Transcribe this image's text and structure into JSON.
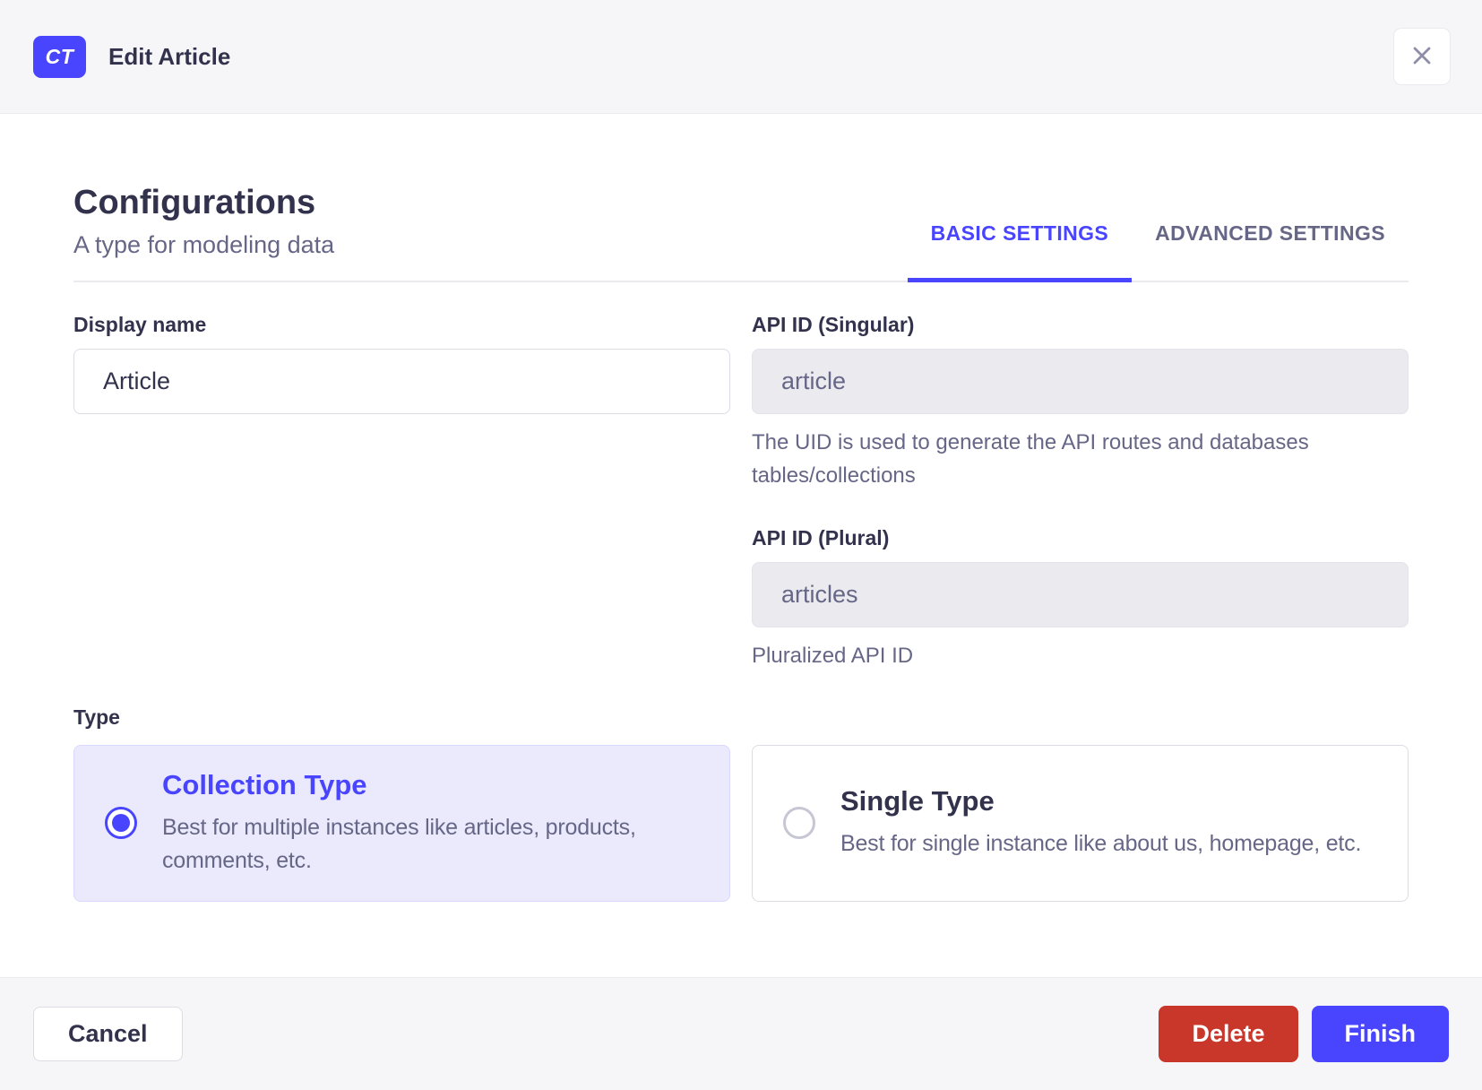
{
  "colors": {
    "primary": "#4945ff",
    "danger": "#c8372a",
    "selected_card_bg": "#eaeafc",
    "header_bg": "#f6f6f9",
    "text_dark": "#32324d",
    "text_muted": "#666687"
  },
  "header": {
    "badge": "CT",
    "title": "Edit Article"
  },
  "section": {
    "title": "Configurations",
    "subtitle": "A type for modeling data"
  },
  "tabs": {
    "basic": "BASIC SETTINGS",
    "advanced": "ADVANCED SETTINGS"
  },
  "form": {
    "display_name": {
      "label": "Display name",
      "value": "Article"
    },
    "api_id_singular": {
      "label": "API ID (Singular)",
      "value": "article",
      "helper": "The UID is used to generate the API routes and databases tables/collections"
    },
    "api_id_plural": {
      "label": "API ID (Plural)",
      "value": "articles",
      "helper": "Pluralized API ID"
    },
    "type_label": "Type",
    "types": {
      "collection": {
        "title": "Collection Type",
        "description": "Best for multiple instances like articles, products, comments, etc.",
        "selected": true
      },
      "single": {
        "title": "Single Type",
        "description": "Best for single instance like about us, homepage, etc.",
        "selected": false
      }
    }
  },
  "footer": {
    "cancel": "Cancel",
    "delete": "Delete",
    "finish": "Finish"
  }
}
